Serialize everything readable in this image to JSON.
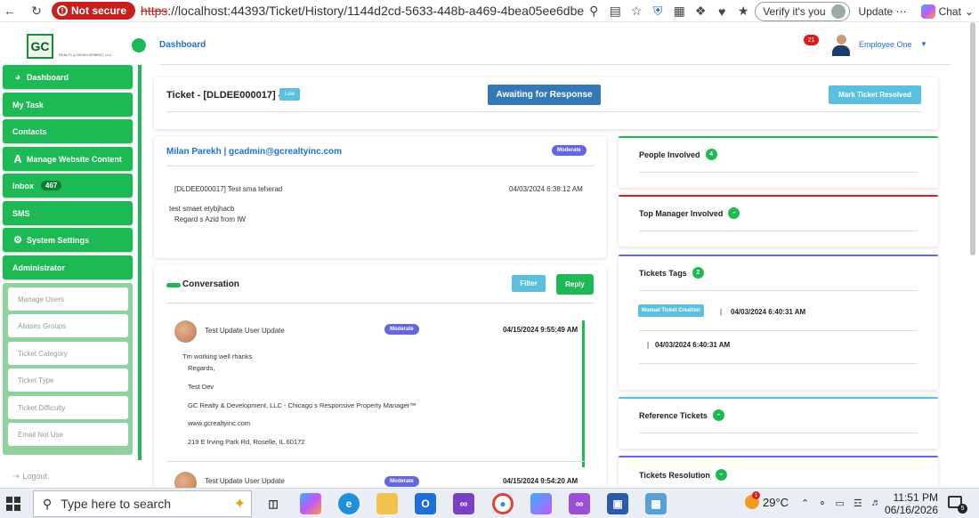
{
  "browser": {
    "security_label": "Not secure",
    "url_scheme": "https",
    "url_rest": "://localhost:44393/Ticket/History/1144d2cd-5633-448b-a469-4bea05ee6dbe",
    "verify_label": "Verify it's you",
    "update_label": "Update",
    "chat_label": "Chat"
  },
  "header": {
    "logo_text": "GC",
    "logo_sub": "REALTY & DEVELOPMENT, LLC",
    "breadcrumb": "Dashboard",
    "notification_count": "21",
    "user_name": "Employee One"
  },
  "sidebar": {
    "items": [
      {
        "label": "Dashboard",
        "icon": "dashboard-icon"
      },
      {
        "label": "My Task"
      },
      {
        "label": "Contacts"
      },
      {
        "label": "Manage Website Content",
        "icon": "a-icon"
      },
      {
        "label": "Inbox",
        "badge": "467"
      },
      {
        "label": "SMS"
      },
      {
        "label": "System Settings",
        "icon": "gears-icon"
      },
      {
        "label": "Administrator"
      }
    ],
    "admin_sub_items": [
      "Manage Users",
      "Aliases Groups",
      "Ticket Category",
      "Ticket Type",
      "Ticket Difficulty",
      "Email Not Use"
    ],
    "logout_label": "Logout"
  },
  "ticket": {
    "title": "Ticket - [DLDEE000017] -",
    "priority": "Low",
    "status": "Awaiting for Response",
    "resolve_label": "Mark Ticket Resolved"
  },
  "first_message": {
    "from": "Milan Parekh | gcadmin@gcrealtyinc.com",
    "difficulty": "Moderate",
    "subject": "[DLDEE000017] Test sma teherad",
    "date": "04/03/2024 6:38:12 AM",
    "body_line1": "test smaet etybjhacb",
    "body_line2": "Regard s Azid from IW"
  },
  "conversation": {
    "title": "Conversation",
    "filter_label": "Filter",
    "reply_label": "Reply",
    "messages": [
      {
        "name": "Test Update User Update",
        "difficulty": "Moderate",
        "date": "04/15/2024 9:55:49 AM",
        "lines": [
          "Tm working well rhanks",
          "Regards,",
          "Test Dev",
          "GC Realty & Development, LLC - Chicago s Responsive Property Manager™",
          "www.gcrealtyinc.com",
          "219 E Irving Park Rd, Roselle, IL 60172"
        ]
      },
      {
        "name": "Test Update User Update",
        "difficulty": "Moderate",
        "date": "04/15/2024 9:54:20 AM"
      }
    ]
  },
  "panels": {
    "people": {
      "title": "People Involved",
      "count": "4",
      "color": "#1db954"
    },
    "top_manager": {
      "title": "Top Manager Involved",
      "count": "–",
      "color": "#d91c1c"
    },
    "tags": {
      "title": "Tickets Tags",
      "count": "2",
      "color": "#6666e0",
      "tag_label": "Manual Ticket Creation",
      "sep": "|",
      "tag_date_1": "04/03/2024 6:40:31 AM",
      "tag_date_2": "04/03/2024 6:40:31 AM"
    },
    "reference": {
      "title": "Reference Tickets",
      "count": "–",
      "color": "#5bc0de"
    },
    "resolution": {
      "title": "Tickets Resolution",
      "count": "–",
      "color": "#6666e0"
    }
  },
  "taskbar": {
    "search_placeholder": "Type here to search",
    "weather_badge": "1",
    "temperature": "29°C",
    "time": "11:51 PM",
    "date": "06/16/2026",
    "chat_count": "5"
  }
}
